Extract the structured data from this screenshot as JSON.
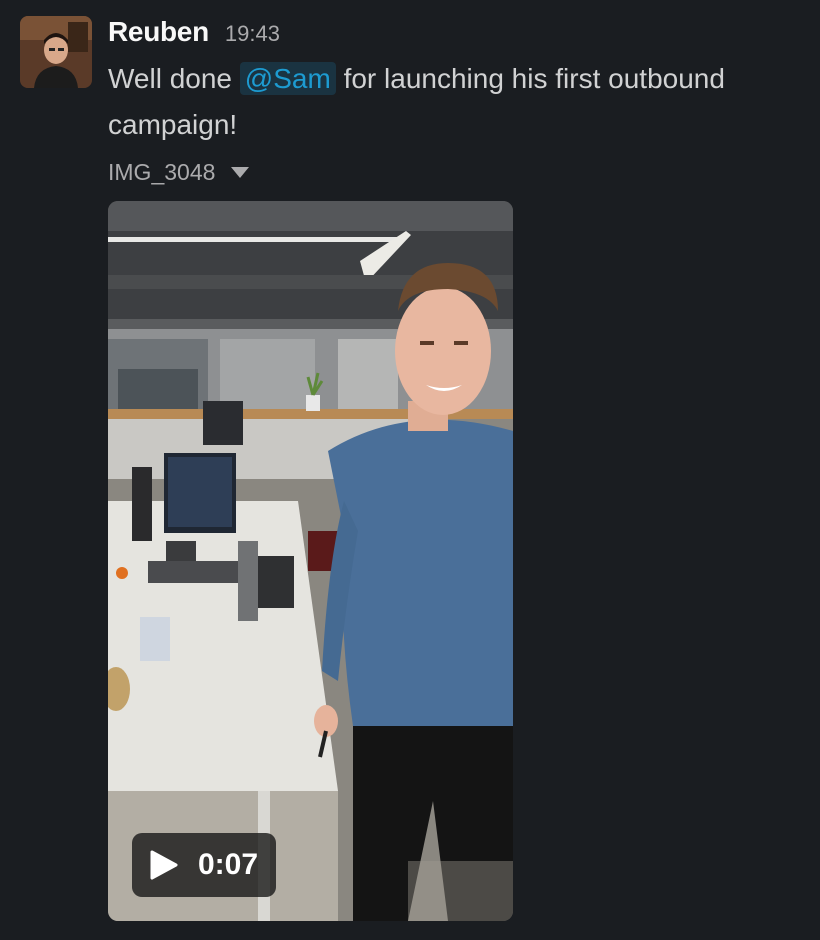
{
  "message": {
    "sender": "Reuben",
    "timestamp": "19:43",
    "text_before": "Well done ",
    "mention": "@Sam",
    "text_after": " for launching his first outbound campaign!"
  },
  "attachment": {
    "file_name": "IMG_3048",
    "duration": "0:07"
  },
  "colors": {
    "background": "#1a1d21",
    "mention": "#1d9bd1",
    "muted": "#ababad"
  }
}
